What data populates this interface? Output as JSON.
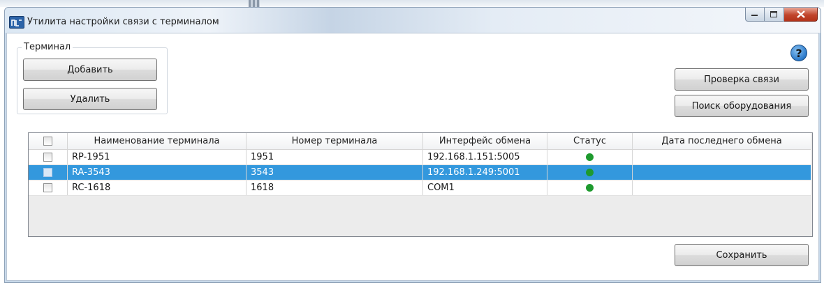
{
  "window": {
    "title": "Утилита настройки связи с терминалом"
  },
  "terminal_group": {
    "legend": "Терминал",
    "add_label": "Добавить",
    "delete_label": "Удалить"
  },
  "actions": {
    "check_connection_label": "Проверка связи",
    "find_equipment_label": "Поиск оборудования",
    "save_label": "Сохранить"
  },
  "table": {
    "columns": [
      "Наименование терминала",
      "Номер терминала",
      "Интерфейс обмена",
      "Статус",
      "Дата последнего обмена"
    ],
    "rows": [
      {
        "name": "RP-1951",
        "number": "1951",
        "interface": "192.168.1.151:5005",
        "last_exchange": "",
        "selected": false
      },
      {
        "name": "RA-3543",
        "number": "3543",
        "interface": "192.168.1.249:5001",
        "last_exchange": "",
        "selected": true
      },
      {
        "name": "RC-1618",
        "number": "1618",
        "interface": "COM1",
        "last_exchange": "",
        "selected": false
      }
    ]
  },
  "colors": {
    "selection": "#3398dd",
    "status_ok": "#1e9a2e",
    "close_button": "#c1452b"
  }
}
